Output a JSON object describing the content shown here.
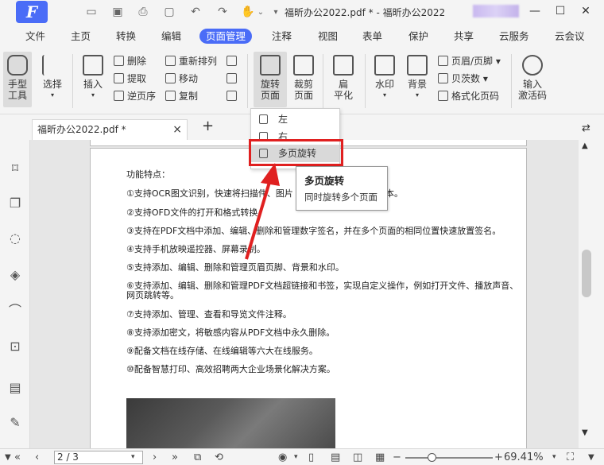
{
  "titlebar": {
    "logo_letter": "F",
    "doc_title": "福昕办公2022.pdf * - 福昕办公2022",
    "quick_access": [
      "open-folder-icon",
      "save-icon",
      "print-icon",
      "undo-icon",
      "redo-icon",
      "hand-tool-icon",
      "dropdown-icon"
    ],
    "window_controls": [
      "minimize-icon",
      "maximize-icon",
      "close-icon"
    ]
  },
  "menu": {
    "tabs": [
      "文件",
      "主页",
      "转换",
      "编辑",
      "页面管理",
      "注释",
      "视图",
      "表单",
      "保护",
      "共享",
      "云服务",
      "云会议"
    ],
    "active_tab": "页面管理"
  },
  "toolbar": {
    "hand_label_1": "手型",
    "hand_label_2": "工具",
    "select_label": "选择",
    "insert_label": "插入",
    "delete_label": "删除",
    "extract_label": "提取",
    "reverse_label": "逆页序",
    "reorder_label": "重新排列",
    "move_label": "移动",
    "copy_label": "复制",
    "rotate_label_1": "旋转",
    "rotate_label_2": "页面",
    "crop_label_1": "裁剪",
    "crop_label_2": "页面",
    "flatten_label_1": "扁",
    "flatten_label_2": "平化",
    "watermark_label": "水印",
    "background_label": "背景",
    "header_footer_label": "页眉/页脚",
    "bates_label": "贝茨数",
    "format_page_label": "格式化页码",
    "input_code_label_1": "输入",
    "input_code_label_2": "激活码"
  },
  "doc_tab": {
    "label": "福昕办公2022.pdf *",
    "close": "×",
    "add": "+"
  },
  "dropdown": {
    "items": [
      "左",
      "右",
      "多页旋转"
    ]
  },
  "tooltip": {
    "title": "多页旋转",
    "description": "同时旋转多个页面"
  },
  "document": {
    "heading": "功能特点：",
    "lines": [
      "①支持OCR图文识别，快速将扫描件、图片",
      "②支持OFD文件的打开和格式转换。",
      "③支持在PDF文档中添加、编辑、删除和管理数字签名，并在多个页面的相同位置快速放置签名。",
      "④支持手机放映遥控器、屏幕录制。",
      "⑤支持添加、编辑、删除和管理页眉页脚、背景和水印。",
      "⑥支持添加、编辑、删除和管理PDF文档超链接和书签，实现自定义操作，例如打开文件、播放声音、",
      "网页跳转等。",
      "⑦支持添加、管理、查看和导览文件注释。",
      "⑧支持添加密文，将敏感内容从PDF文档中永久删除。",
      "⑨配备文档在线存储、在线编辑等六大在线服务。",
      "⑩配备智慧打印、高效招聘两大企业场景化解决方案。"
    ],
    "line1_tail": "文本。"
  },
  "sidebar": {
    "icons": [
      "bookmark-icon",
      "pages-icon",
      "comment-icon",
      "layers-icon",
      "attachment-icon",
      "security-icon",
      "document-icon",
      "signature-icon"
    ]
  },
  "statusbar": {
    "page_value": "2 / 3",
    "zoom_value": "69.41%",
    "zoom_fraction": 0.3
  },
  "colors": {
    "accent": "#4a6cf7",
    "highlight_box": "#e02020",
    "arrow": "#e02020"
  }
}
